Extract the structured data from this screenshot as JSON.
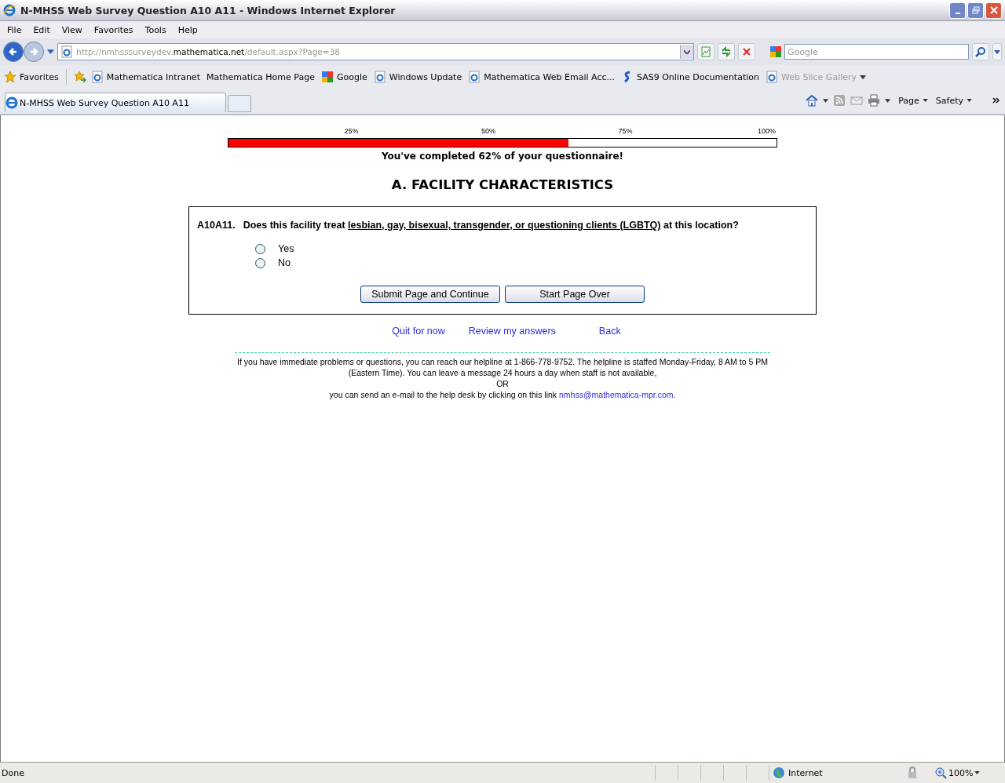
{
  "window": {
    "title": "N-MHSS Web Survey Question A10 A11 - Windows Internet Explorer"
  },
  "menu": [
    "File",
    "Edit",
    "View",
    "Favorites",
    "Tools",
    "Help"
  ],
  "address": {
    "prefix": "http://nmhsssurveydev.",
    "domain": "mathematica.net",
    "path": "/default.aspx?Page=38"
  },
  "search": {
    "placeholder": "Google"
  },
  "favorites": {
    "label": "Favorites",
    "items": [
      {
        "label": "Mathematica Intranet",
        "kind": "ie",
        "disabled": false
      },
      {
        "label": "Mathematica Home Page",
        "kind": "none",
        "disabled": false
      },
      {
        "label": "Google",
        "kind": "google",
        "disabled": false
      },
      {
        "label": "Windows Update",
        "kind": "ie",
        "disabled": false
      },
      {
        "label": "Mathematica Web Email Acc...",
        "kind": "ie",
        "disabled": false
      },
      {
        "label": "SAS9 Online Documentation",
        "kind": "sas",
        "disabled": false
      },
      {
        "label": "Web Slice Gallery",
        "kind": "ie",
        "disabled": true
      }
    ]
  },
  "tab": {
    "label": "N-MHSS Web Survey Question A10 A11",
    "selected": true
  },
  "commands": [
    "Page",
    "Safety"
  ],
  "progress": {
    "ticks": [
      "25%",
      "50%",
      "75%",
      "100%"
    ],
    "level": 0.62,
    "caption": "You've completed 62% of your questionnaire!"
  },
  "section": "A. FACILITY CHARACTERISTICS",
  "question": {
    "number": "A10A11.",
    "before": "Does this facility treat",
    "underlined": "lesbian, gay, bisexual, transgender, or questioning clients (LGBTQ)",
    "after": "at this location?",
    "options": [
      {
        "label": "Yes",
        "selected": false
      },
      {
        "label": "No",
        "selected": false
      }
    ]
  },
  "buttons": [
    "Submit Page and Continue",
    "Start Page Over"
  ],
  "links": [
    "Quit for now",
    "Review my answers",
    "Back"
  ],
  "footer": {
    "line1": "If you have immediate problems or questions, you can reach our helpline at 1-866-778-9752. The helpline is staffed Monday-Friday, 8 AM to 5 PM (Eastern Time). You can leave a message 24 hours a day when staff is not available,",
    "or": "OR",
    "line3": "you can send an e-mail to the help desk by clicking on this link",
    "email": "nmhss@mathematica-mpr.com."
  },
  "status_bar": {
    "text": "Done",
    "zone": "Internet",
    "zoom": "100%"
  }
}
